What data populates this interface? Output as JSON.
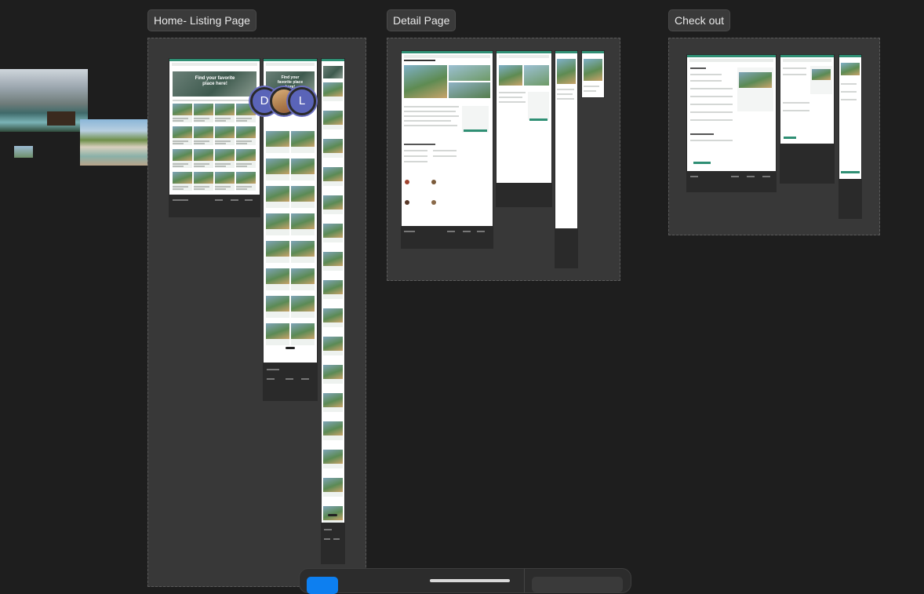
{
  "sections": [
    {
      "id": "home",
      "label": "Home- Listing Page"
    },
    {
      "id": "detail",
      "label": "Detail Page"
    },
    {
      "id": "checkout",
      "label": "Check out"
    }
  ],
  "collaborators": [
    {
      "initial": "D",
      "color": "#5a64b8"
    },
    {
      "initial": "",
      "color": "#c8a26b"
    },
    {
      "initial": "L",
      "color": "#5a64b8"
    }
  ],
  "home_hero_text": "Find your favorite place here!",
  "colors": {
    "canvas": "#1e1e1e",
    "section": "#383838",
    "accent": "#2f8f74",
    "footer": "#2a2a2a",
    "selected_tool": "#0d7ff0"
  }
}
